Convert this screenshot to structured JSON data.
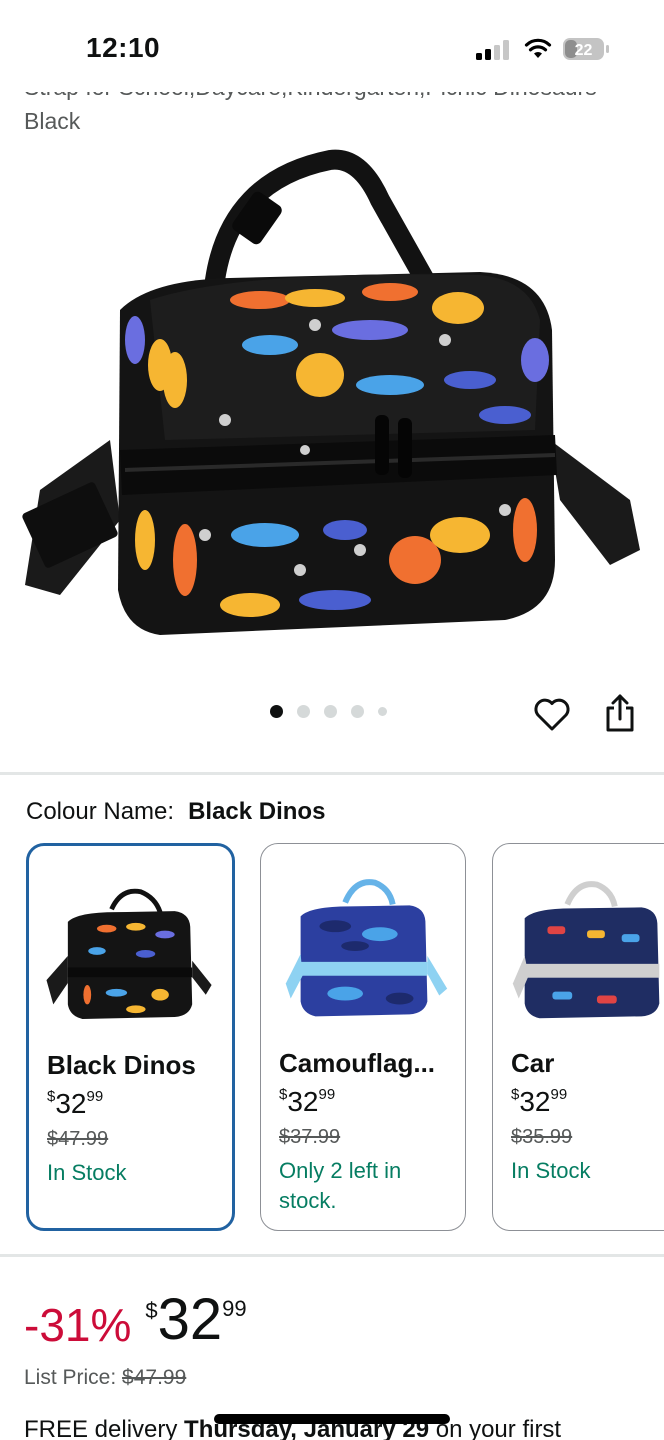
{
  "status": {
    "time": "12:10",
    "battery": "22"
  },
  "product": {
    "title_line1": "Strap for School,Daycare,Kindergarten,Picnic Dinosaurs",
    "title_line2": "Black",
    "image": "lunch-bag-black-dinos-image"
  },
  "carousel": {
    "dots": 5,
    "active": 0
  },
  "actions": {
    "wishlist": "heart-icon",
    "share": "share-icon"
  },
  "colour": {
    "label": "Colour Name:",
    "value": "Black Dinos"
  },
  "swatches": [
    {
      "name": "Black Dinos",
      "whole": "32",
      "fraction": "99",
      "currency": "$",
      "was": "$47.99",
      "stock": "In Stock",
      "selected": true
    },
    {
      "name": "Camouflag...",
      "whole": "32",
      "fraction": "99",
      "currency": "$",
      "was": "$37.99",
      "stock": "Only 2 left in stock.",
      "selected": false
    },
    {
      "name": "Car",
      "whole": "32",
      "fraction": "99",
      "currency": "$",
      "was": "$35.99",
      "stock": "In Stock",
      "selected": false
    }
  ],
  "price": {
    "discount": "-31%",
    "currency": "$",
    "whole": "32",
    "fraction": "99"
  },
  "list_price": {
    "label": "List Price:",
    "value": "$47.99"
  },
  "delivery": {
    "prefix": "FREE delivery",
    "date": "Thursday, January 29",
    "suffix": "on your first"
  },
  "colors": {
    "deal_red": "#cc0c39",
    "stock_green": "#067d62",
    "selected_blue": "#2162a1"
  }
}
